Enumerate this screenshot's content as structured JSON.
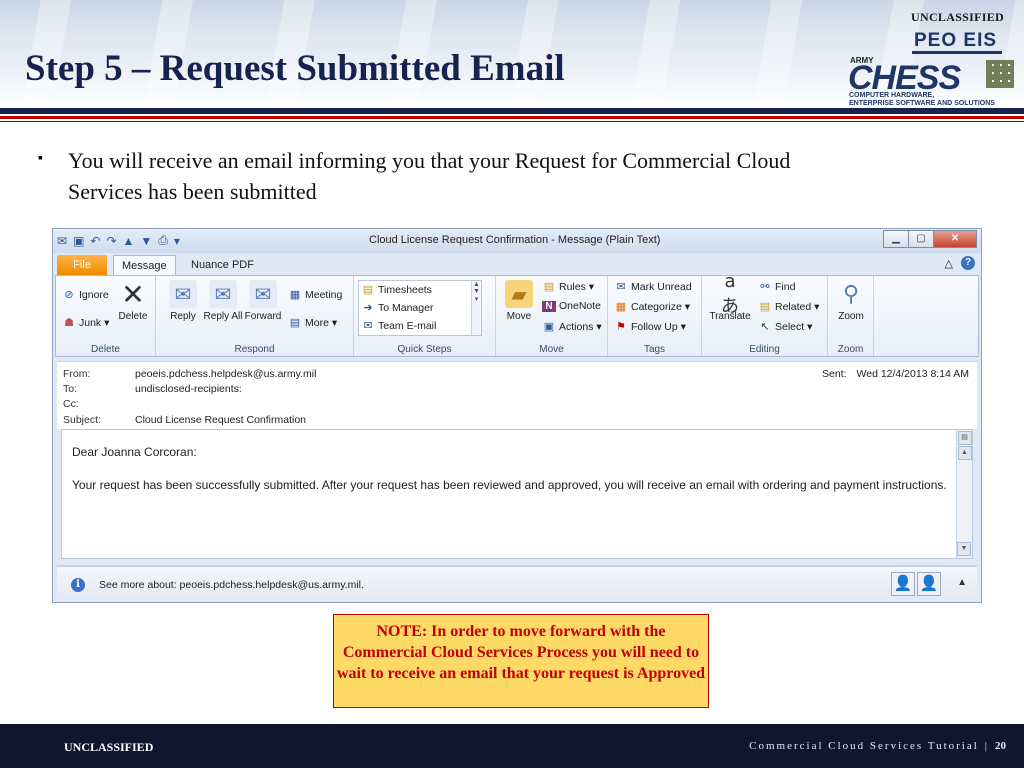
{
  "slide": {
    "classification_top": "UNCLASSIFIED",
    "title": "Step 5 – Request Submitted Email",
    "bullet_mark": "▪",
    "bullet_text": "You will receive an email informing you that your Request for Commercial Cloud Services has been submitted",
    "note": "NOTE: In order to move forward with the Commercial Cloud Services Process you will need to wait to receive an email that your request is Approved"
  },
  "logo": {
    "army": "ARMY",
    "peo": "PEO EIS",
    "chess": "CHESS",
    "tagline1": "COMPUTER HARDWARE,",
    "tagline2": "ENTERPRISE SOFTWARE AND SOLUTIONS"
  },
  "footer": {
    "classification": "UNCLASSIFIED",
    "title": "Commercial Cloud Services Tutorial",
    "separator": "|",
    "page": "20"
  },
  "outlook": {
    "window_title": "Cloud License Request Confirmation  -  Message (Plain Text)",
    "window_buttons": {
      "minimize": "▁",
      "maximize": "▢",
      "close": "✕"
    },
    "tabs": {
      "file": "File",
      "message": "Message",
      "nuance": "Nuance PDF"
    },
    "ribbon_right": {
      "collapse": "△",
      "help": "?"
    },
    "groups": {
      "delete": {
        "label": "Delete",
        "ignore": "Ignore",
        "junk": "Junk ▾",
        "delete": "Delete"
      },
      "respond": {
        "label": "Respond",
        "reply": "Reply",
        "reply_all": "Reply All",
        "forward": "Forward",
        "meeting": "Meeting",
        "more": "More ▾"
      },
      "quick_steps": {
        "label": "Quick Steps",
        "timesheets": "Timesheets",
        "to_manager": "To Manager",
        "team_email": "Team E-mail"
      },
      "move": {
        "label": "Move",
        "move": "Move",
        "rules": "Rules ▾",
        "onenote": "OneNote",
        "actions": "Actions ▾"
      },
      "tags": {
        "label": "Tags",
        "mark_unread": "Mark Unread",
        "categorize": "Categorize ▾",
        "follow_up": "Follow Up ▾"
      },
      "editing": {
        "label": "Editing",
        "translate": "Translate",
        "find": "Find",
        "related": "Related ▾",
        "select": "Select ▾"
      },
      "zoom": {
        "label": "Zoom",
        "zoom": "Zoom"
      }
    },
    "header": {
      "from_label": "From:",
      "from_value": "peoeis.pdchess.helpdesk@us.army.mil",
      "to_label": "To:",
      "to_value": "undisclosed-recipients:",
      "cc_label": "Cc:",
      "cc_value": "",
      "subject_label": "Subject:",
      "subject_value": "Cloud License Request Confirmation",
      "sent_label": "Sent:",
      "sent_value": "Wed 12/4/2013 8:14 AM"
    },
    "body": {
      "greeting": "Dear Joanna Corcoran:",
      "message": "Your request has been successfully submitted. After your request has been reviewed and approved, you will receive an email with ordering and payment instructions."
    },
    "people_pane": {
      "see_more": "See more about: peoeis.pdchess.helpdesk@us.army.mil.",
      "collapse": "▲"
    }
  }
}
